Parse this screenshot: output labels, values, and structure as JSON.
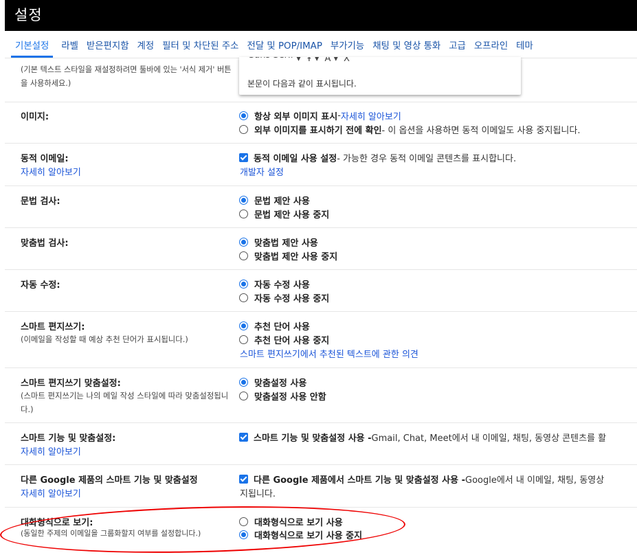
{
  "header": {
    "title": "설정"
  },
  "tabs": [
    "기본설정",
    "라벨",
    "받은편지함",
    "계정",
    "필터 및 차단된 주소",
    "전달 및 POP/IMAP",
    "부가기능",
    "채팅 및 영상 통화",
    "고급",
    "오프라인",
    "테마"
  ],
  "font_popup": {
    "font": "Sans Serif",
    "size_icon": "text-size-icon",
    "color_icon": "text-color-icon",
    "clear_icon": "clear-formatting-icon",
    "preview": "본문이 다음과 같이 표시됩니다."
  },
  "text_style_hint": "(기본 텍스트 스타일을 재설정하려면 툴바에 있는 '서식 제거' 버튼을 사용하세요.)",
  "images": {
    "label": "이미지:",
    "opt1_bold": "항상 외부 이미지 표시",
    "opt1_sep": " - ",
    "opt1_link": "자세히 알아보기",
    "opt2_bold": "외부 이미지를 표시하기 전에 확인",
    "opt2_rest": " - 이 옵션을 사용하면 동적 이메일도 사용 중지됩니다."
  },
  "dynamic_email": {
    "label": "동적 이메일:",
    "learn_more": "자세히 알아보기",
    "opt_bold": "동적 이메일 사용 설정",
    "opt_rest": " - 가능한 경우 동적 이메일 콘텐츠를 표시합니다.",
    "dev_link": "개발자 설정"
  },
  "grammar": {
    "label": "문법 검사:",
    "on": "문법 제안 사용",
    "off": "문법 제안 사용 중지"
  },
  "spelling": {
    "label": "맞춤법 검사:",
    "on": "맞춤법 제안 사용",
    "off": "맞춤법 제안 사용 중지"
  },
  "autocorrect": {
    "label": "자동 수정:",
    "on": "자동 수정 사용",
    "off": "자동 수정 사용 중지"
  },
  "smart_compose": {
    "label": "스마트 편지쓰기:",
    "sub": "(이메일을 작성할 때 예상 추천 단어가 표시됩니다.)",
    "on": "추천 단어 사용",
    "off": "추천 단어 사용 중지",
    "feedback": "스마트 편지쓰기에서 추천된 텍스트에 관한 의견"
  },
  "smart_compose_personal": {
    "label": "스마트 편지쓰기 맞춤설정:",
    "sub": "(스마트 편지쓰기는 나의 메일 작성 스타일에 따라 맞춤설정됩니다.)",
    "on": "맞춤설정 사용",
    "off": "맞춤설정 사용 안함"
  },
  "smart_features": {
    "label": "스마트 기능 및 맞춤설정:",
    "learn_more": "자세히 알아보기",
    "opt_bold": "스마트 기능 및 맞춤설정 사용 -",
    "opt_rest": " Gmail, Chat, Meet에서 내 이메일, 채팅, 동영상 콘텐츠를 활"
  },
  "other_google": {
    "label": "다른 Google 제품의 스마트 기능 및 맞춤설정",
    "learn_more": "자세히 알아보기",
    "opt_bold": "다른 Google 제품에서 스마트 기능 및 맞춤설정 사용 -",
    "opt_rest": " Google에서 내 이메일, 채팅, 동영상",
    "cont": "지됩니다."
  },
  "conversation_view": {
    "label": "대화형식으로 보기:",
    "sub": "(동일한 주제의 이메일을 그룹화할지 여부를 설정합니다.)",
    "on": "대화형식으로 보기 사용",
    "off": "대화형식으로 보기 사용 중지"
  },
  "colors": {
    "accent": "#1a73e8",
    "link": "#1a54d8",
    "annotation": "#ee0000"
  }
}
